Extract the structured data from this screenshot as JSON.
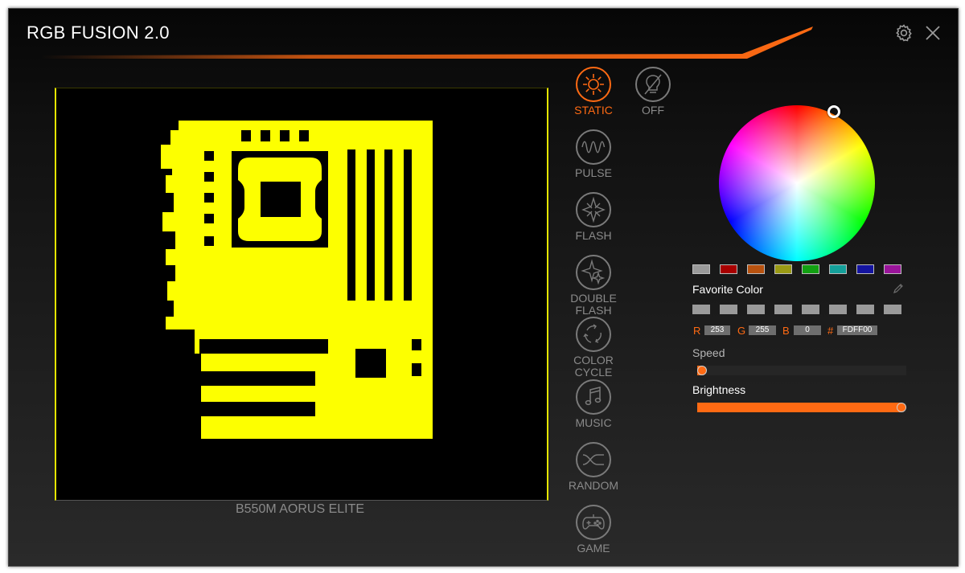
{
  "window": {
    "title": "RGB FUSION 2.0"
  },
  "header": {
    "settings_icon": "gear-icon",
    "close_icon": "close-icon"
  },
  "preview": {
    "model_name": "B550M AORUS ELITE",
    "led_color": "#FDFF00"
  },
  "modes": [
    {
      "id": "static",
      "label": "STATIC",
      "icon": "sun-icon",
      "active": true
    },
    {
      "id": "off",
      "label": "OFF",
      "icon": "light-off-icon",
      "active": false
    },
    {
      "id": "pulse",
      "label": "PULSE",
      "icon": "wave-icon",
      "active": false
    },
    {
      "id": "flash",
      "label": "FLASH",
      "icon": "star-burst-icon",
      "active": false
    },
    {
      "id": "double-flash",
      "label": "DOUBLE\nFLASH",
      "icon": "double-star-icon",
      "active": false
    },
    {
      "id": "color-cycle",
      "label": "COLOR\nCYCLE",
      "icon": "cycle-arrows-icon",
      "active": false
    },
    {
      "id": "music",
      "label": "MUSIC",
      "icon": "music-note-icon",
      "active": false
    },
    {
      "id": "random",
      "label": "RANDOM",
      "icon": "shuffle-icon",
      "active": false
    },
    {
      "id": "game",
      "label": "GAME",
      "icon": "gamepad-icon",
      "active": false
    }
  ],
  "color_panel": {
    "preset_colors": [
      "#9a9a9a",
      "#a80000",
      "#b8520f",
      "#9a9a14",
      "#12a012",
      "#14a09a",
      "#1414a0",
      "#9a149a"
    ],
    "favorite_color_label": "Favorite Color",
    "edit_icon": "pencil-icon",
    "favorite_slots": 8,
    "favorite_color": "#9a9a9a",
    "r_label": "R",
    "r_value": "253",
    "g_label": "G",
    "g_value": "255",
    "b_label": "B",
    "b_value": "0",
    "hex_label": "#",
    "hex_value": "FDFF00"
  },
  "speed": {
    "label": "Speed",
    "value": 0.0
  },
  "brightness": {
    "label": "Brightness",
    "value": 1.0
  },
  "theme": {
    "accent": "#ff6a13",
    "inactive": "#7a7a7a"
  }
}
